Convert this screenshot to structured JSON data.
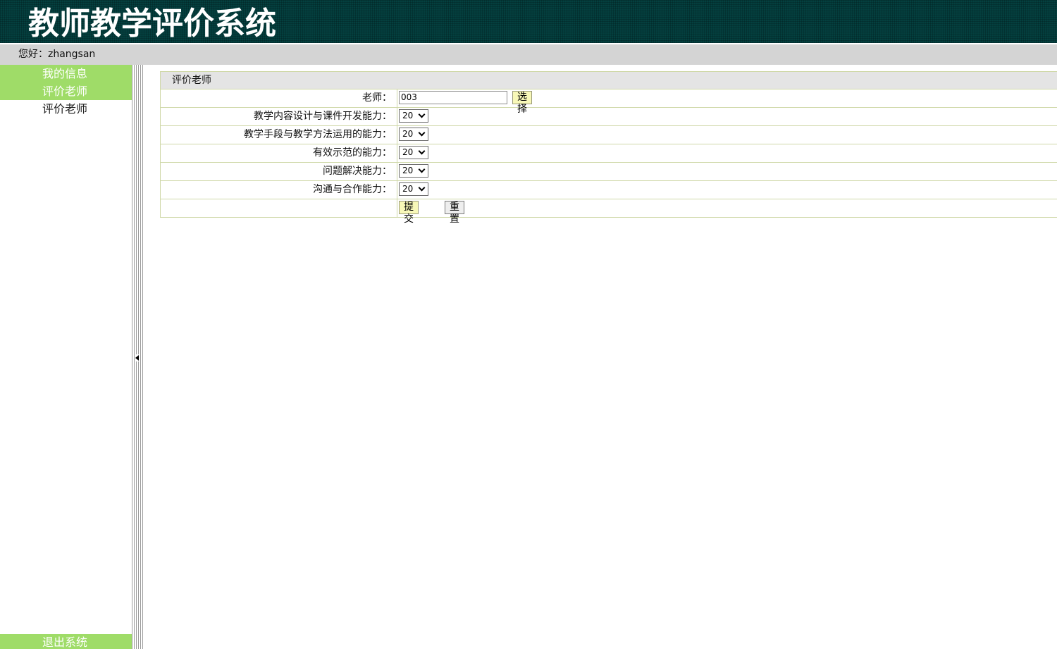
{
  "app": {
    "title": "教师教学评价系统",
    "greeting": "您好：zhangsan"
  },
  "sidebar": {
    "items": [
      {
        "label": "我的信息"
      },
      {
        "label": "评价老师"
      },
      {
        "label": "评价老师"
      }
    ],
    "exit_label": "退出系统"
  },
  "form": {
    "title": "评价老师",
    "teacher": {
      "label": "老师：",
      "value": "003",
      "select_button": "选择"
    },
    "criteria": [
      {
        "label": "教学内容设计与课件开发能力：",
        "value": "20"
      },
      {
        "label": "教学手段与教学方法运用的能力：",
        "value": "20"
      },
      {
        "label": "有效示范的能力：",
        "value": "20"
      },
      {
        "label": "问题解决能力：",
        "value": "20"
      },
      {
        "label": "沟通与合作能力：",
        "value": "20"
      }
    ],
    "submit_label": "提交",
    "reset_label": "重置"
  },
  "colors": {
    "banner": "#04403f",
    "menu_active": "#9fdc68",
    "user_bar": "#d4d4d4",
    "button_yellow": "#f8f8b8",
    "table_border": "#cfd8a8"
  }
}
